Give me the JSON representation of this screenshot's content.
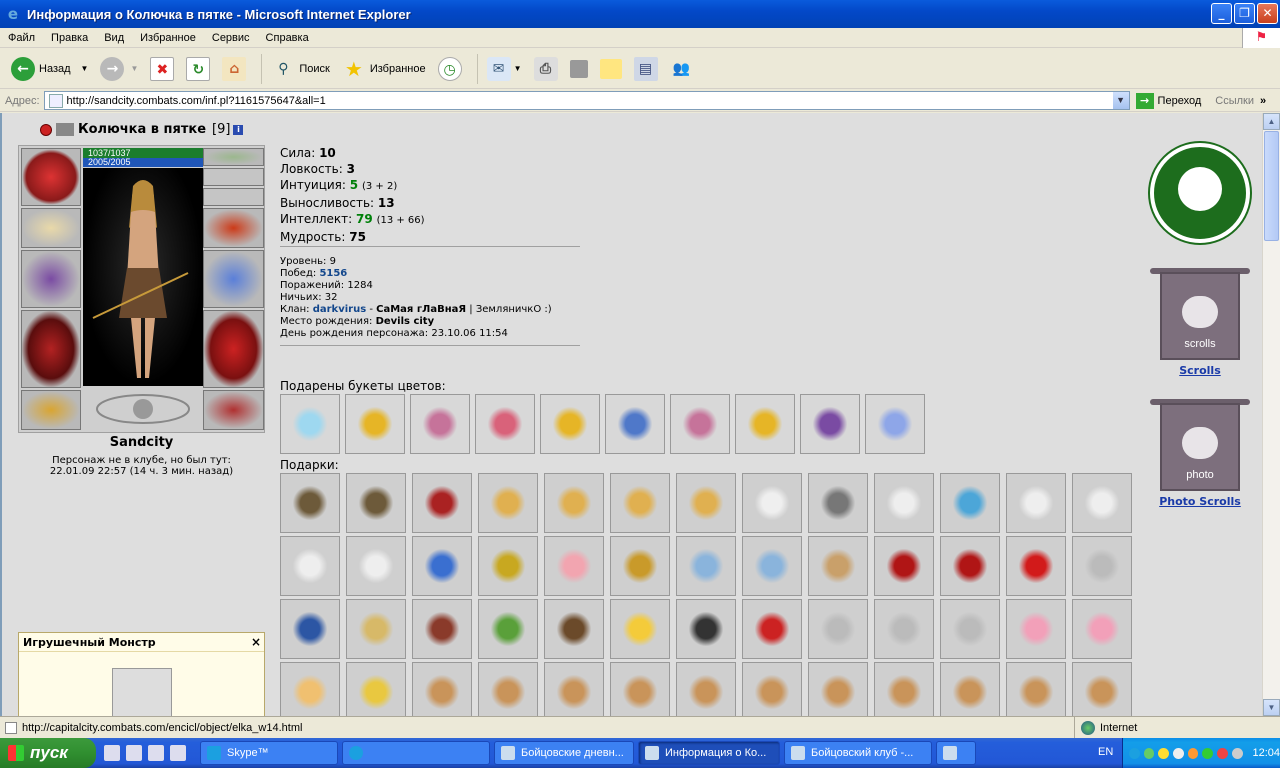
{
  "window": {
    "title": "Информация о Колючка в пятке - Microsoft Internet Explorer"
  },
  "menu": [
    "Файл",
    "Правка",
    "Вид",
    "Избранное",
    "Сервис",
    "Справка"
  ],
  "toolbar": {
    "back": "Назад",
    "search": "Поиск",
    "favorites": "Избранное"
  },
  "address": {
    "label": "Адрес:",
    "url": "http://sandcity.combats.com/inf.pl?1161575647&all=1",
    "go": "Переход",
    "links": "Ссылки"
  },
  "character": {
    "name": "Колючка в пятке",
    "level": "[9]",
    "hp": "1037/1037",
    "mana": "2005/2005",
    "city": "Sandcity",
    "away_line1": "Персонаж не в клубе, но был тут:",
    "away_line2": "22.01.09 22:57 (14 ч. 3 мин. назад)"
  },
  "stats": {
    "str_label": "Сила:",
    "str": "10",
    "agi_label": "Ловкость:",
    "agi": "3",
    "int_label": "Интуиция:",
    "int": "5",
    "int_detail": "(3 + 2)",
    "end_label": "Выносливость:",
    "end": "13",
    "intel_label": "Интеллект:",
    "intel": "79",
    "intel_detail": "(13 + 66)",
    "wis_label": "Мудрость:",
    "wis": "75"
  },
  "info": {
    "level": "Уровень: 9",
    "wins_label": "Побед:",
    "wins": "5156",
    "losses": "Поражений: 1284",
    "draws": "Ничьих: 32",
    "clan_label": "Клан:",
    "clan": "darkvirus",
    "clan_rank": "СаМая гЛаВнаЯ",
    "clan_rest": "| ЗемляничкО :)",
    "birth_label": "Место рождения:",
    "birth": "Devils city",
    "bday": "День рождения персонажа: 23.10.06 11:54"
  },
  "flowers_title": "Подарены букеты цветов:",
  "flowers": [
    "ice-flower-icon",
    "gold-tree-icon",
    "pink-lily-icon",
    "red-flower-icon",
    "gold-tree-icon",
    "blue-bouquet-icon",
    "pink-lily-icon",
    "gold-tree-icon",
    "purple-rose-icon",
    "blue-tree-icon"
  ],
  "gifts_title": "Подарки:",
  "gift_rows": [
    [
      "chest",
      "chest",
      "ring-box",
      "key",
      "key",
      "key",
      "key",
      "pearls",
      "wheel",
      "cow",
      "blue-box",
      "cow",
      "cow"
    ],
    [
      "cow",
      "cow",
      "blue-bag",
      "gift-box",
      "pig",
      "gold-dog",
      "milk-can",
      "milk-can",
      "tambourine",
      "red-scroll",
      "red-scroll",
      "red-bag",
      "mouse"
    ],
    [
      "snow-window",
      "wheat",
      "helmet",
      "goblin",
      "staff",
      "cheese",
      "mace",
      "socks",
      "mouse",
      "mouse",
      "mouse",
      "doll",
      "doll"
    ],
    [
      "candle",
      "number-4",
      "bear",
      "bear",
      "bear",
      "bear",
      "bear",
      "bear",
      "bear",
      "bear",
      "bear",
      "bear",
      "bear"
    ]
  ],
  "right": {
    "scrolls": "Scrolls",
    "scrolls_img": "scrolls",
    "photo": "Photo Scrolls",
    "photo_img": "photo"
  },
  "popup": {
    "title": "Игрушечный Монстр",
    "close": "×"
  },
  "status": {
    "url": "http://capitalcity.combats.com/encicl/object/elka_w14.html",
    "zone": "Internet"
  },
  "taskbar": {
    "start": "пуск",
    "tasks": [
      "Skype™",
      "",
      "Бойцовские дневн...",
      "Информация о Ко...",
      "Бойцовский клуб -...",
      ""
    ],
    "lang": "EN",
    "time": "12:04"
  },
  "colors": {
    "hp": "#1b7d2d",
    "mana": "#1f56b8",
    "green_stat": "#00800a",
    "link_blue": "#13478c"
  }
}
